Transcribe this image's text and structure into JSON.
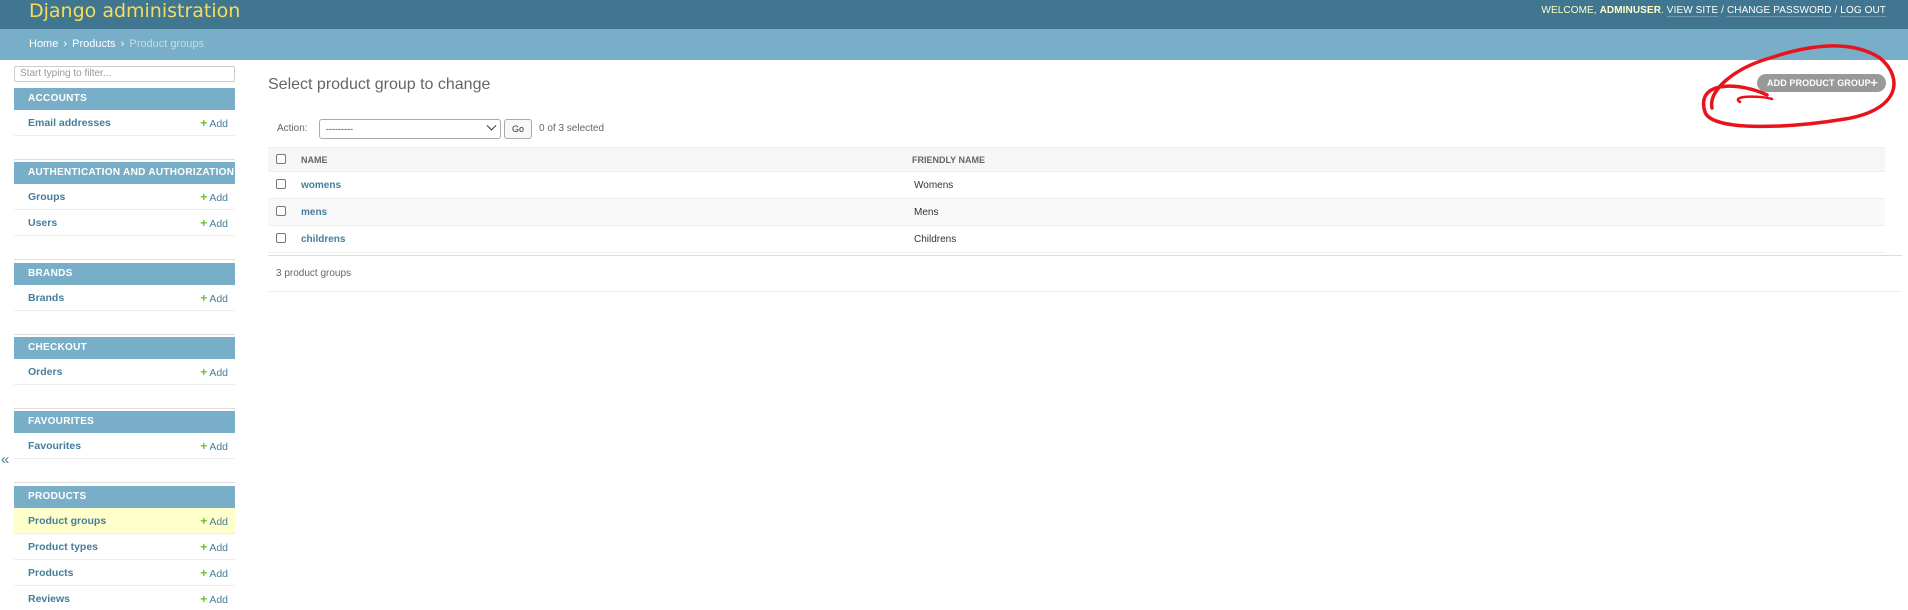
{
  "header": {
    "branding": "Django administration",
    "welcome": "WELCOME,",
    "username": "ADMINUSER",
    "view_site": "VIEW SITE",
    "change_password": "CHANGE PASSWORD",
    "log_out": "LOG OUT",
    "separator": "/"
  },
  "breadcrumbs": {
    "home": "Home",
    "products": "Products",
    "current": "Product groups",
    "separator": "›"
  },
  "sidebar": {
    "filter_placeholder": "Start typing to filter...",
    "add_label": "Add",
    "collapse_glyph": "«",
    "modules": [
      {
        "title": "ACCOUNTS",
        "models": [
          "Email addresses"
        ]
      },
      {
        "title": "AUTHENTICATION AND AUTHORIZATION",
        "models": [
          "Groups",
          "Users"
        ]
      },
      {
        "title": "BRANDS",
        "models": [
          "Brands"
        ]
      },
      {
        "title": "CHECKOUT",
        "models": [
          "Orders"
        ]
      },
      {
        "title": "FAVOURITES",
        "models": [
          "Favourites"
        ]
      },
      {
        "title": "PRODUCTS",
        "models": [
          "Product groups",
          "Product types",
          "Products",
          "Reviews"
        ],
        "current": "Product groups"
      }
    ]
  },
  "main": {
    "title": "Select product group to change",
    "add_button": "ADD PRODUCT GROUP",
    "action_label": "Action:",
    "action_selected": "---------",
    "go_label": "Go",
    "selected_count": "0 of 3 selected",
    "columns": [
      "NAME",
      "FRIENDLY NAME"
    ],
    "rows": [
      {
        "name": "womens",
        "friendly_name": "Womens"
      },
      {
        "name": "mens",
        "friendly_name": "Mens"
      },
      {
        "name": "childrens",
        "friendly_name": "Childrens"
      }
    ],
    "paginator": "3 product groups"
  },
  "colors": {
    "header_bg": "#417690",
    "branding": "#f5dd5d",
    "breadcrumbs_bg": "#79aec8",
    "module_header_bg": "#79aec8",
    "link": "#447e9b",
    "add_plus": "#70bf2b",
    "current_row_bg": "#ffffcc",
    "annotation": "#e8141c"
  }
}
